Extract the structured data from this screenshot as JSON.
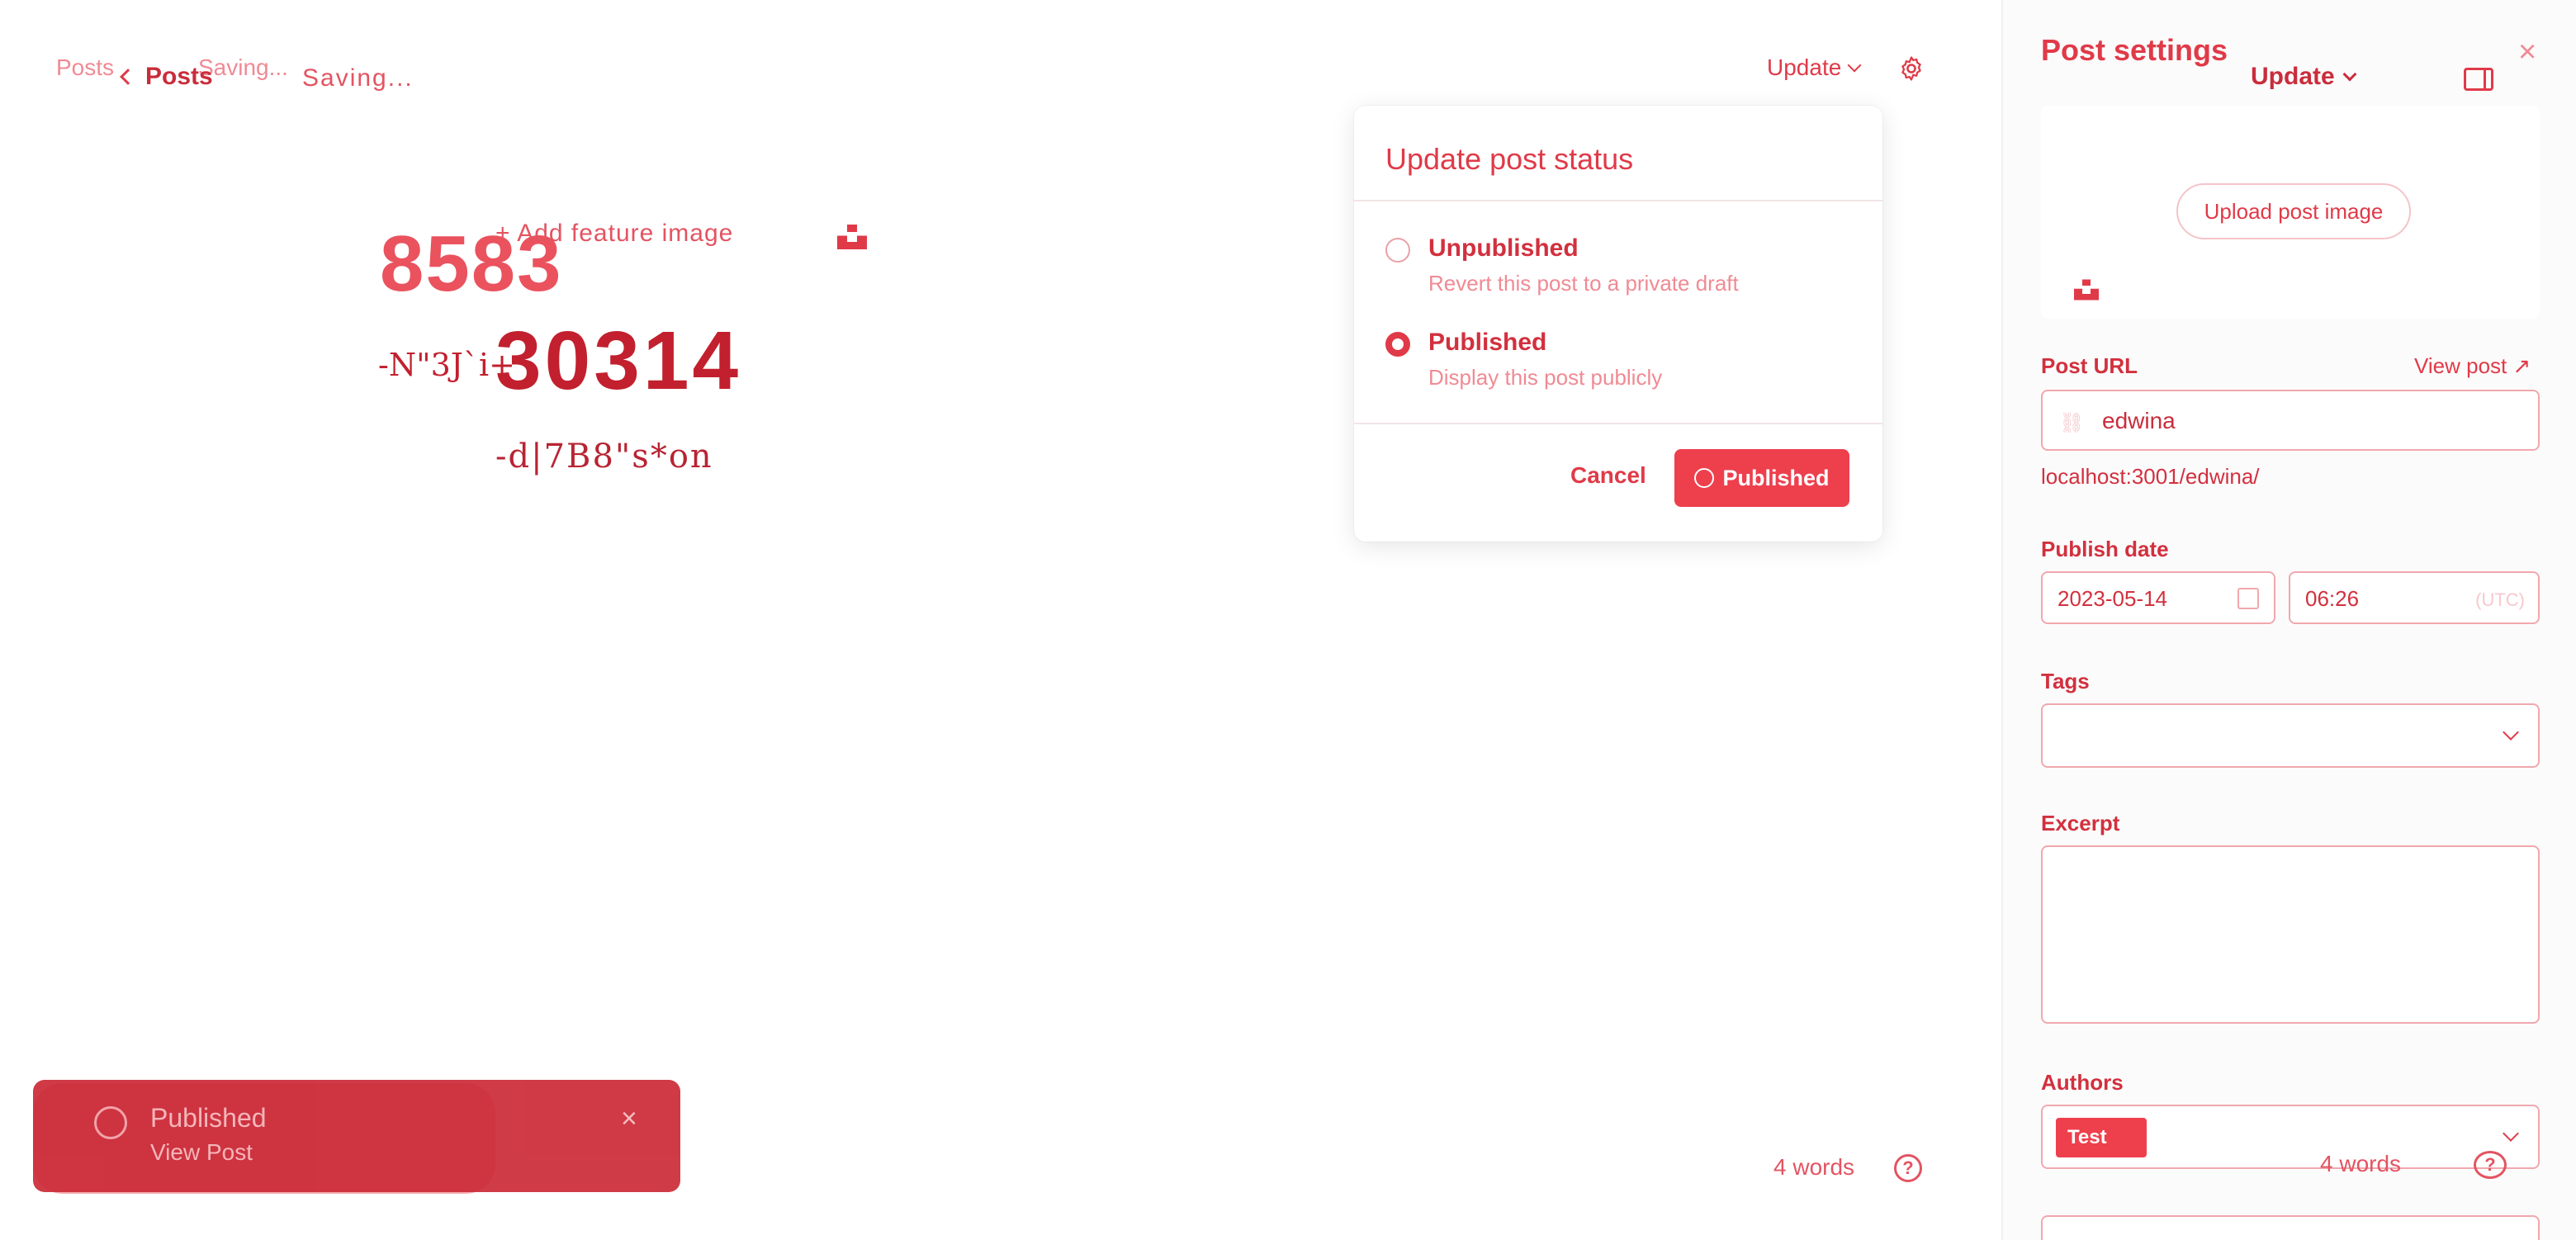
{
  "header": {
    "back_label": "Posts",
    "ghost_back_label": "Posts",
    "saving_status": "Saving...",
    "ghost_saving_status": "Saving...",
    "update_label": "Update",
    "settings_icon": "gear-icon"
  },
  "editor": {
    "feature_image_label": "+ Add feature image",
    "title_ghost": "8583",
    "title": "30314",
    "subtitle_ghost": "-N\"3J`i+",
    "subtitle": "-d|7B8\"s*on",
    "word_count": "4 words",
    "help_icon": "question-circle-icon"
  },
  "status_popover": {
    "title": "Update post status",
    "options": [
      {
        "label": "Unpublished",
        "description": "Revert this post to a private draft",
        "selected": false
      },
      {
        "label": "Published",
        "description": "Display this post publicly",
        "selected": true
      }
    ],
    "cancel_label": "Cancel",
    "confirm_label": "Published"
  },
  "toast": {
    "title": "Published",
    "link": "View Post",
    "close": "×"
  },
  "settings": {
    "title": "Post settings",
    "update_label": "Update",
    "close": "×",
    "upload_label": "Upload post image",
    "post_url_label": "Post URL",
    "view_post_label": "View post ↗",
    "slug": "edwina",
    "url_hint": "localhost:3001/edwina/",
    "publish_date_label": "Publish date",
    "date": "2023-05-14",
    "time": "06:26",
    "timezone": "(UTC)",
    "tags_label": "Tags",
    "excerpt_label": "Excerpt",
    "authors_label": "Authors",
    "author": "Test",
    "word_count": "4 words"
  },
  "colors": {
    "accent": "#ee3f4d",
    "text": "#e03a48",
    "toast": "#cb2a37"
  }
}
